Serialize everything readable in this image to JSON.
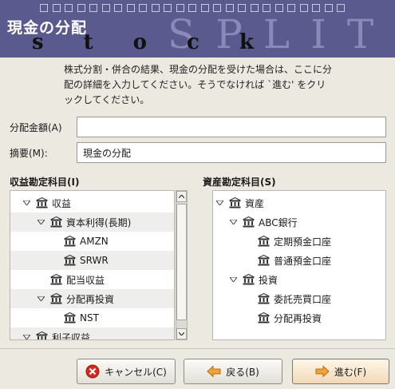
{
  "banner": {
    "title": "現金の分配",
    "deco_stock": "stock",
    "deco_split": "SPLIT"
  },
  "description": "株式分割・併合の結果、現金の分配を受けた場合は、ここに分配の詳細を入力してください。そうでなければ `進む' をクリックしてください。",
  "form": {
    "amount_label": "分配金額(A)",
    "amount_value": "",
    "memo_label": "摘要(M):",
    "memo_value": "現金の分配"
  },
  "income_tree": {
    "title": "収益勘定科目(I)",
    "rows": [
      {
        "label": "収益",
        "expanded": true
      },
      {
        "label": "資本利得(長期)",
        "expanded": true
      },
      {
        "label": "AMZN"
      },
      {
        "label": "SRWR"
      },
      {
        "label": "配当収益"
      },
      {
        "label": "分配再投資",
        "expanded": true
      },
      {
        "label": "NST"
      },
      {
        "label": "利子収益",
        "expanded": true
      }
    ]
  },
  "asset_tree": {
    "title": "資産勘定科目(S)",
    "rows": [
      {
        "label": "資産",
        "expanded": true
      },
      {
        "label": "ABC銀行",
        "expanded": true
      },
      {
        "label": "定期預金口座"
      },
      {
        "label": "普通預金口座"
      },
      {
        "label": "投資",
        "expanded": true
      },
      {
        "label": "委託売買口座"
      },
      {
        "label": "分配再投資"
      }
    ]
  },
  "buttons": {
    "cancel": "キャンセル(C)",
    "back": "戻る(B)",
    "next": "進む(F)"
  },
  "icons": {
    "account": "bank-icon",
    "expander": "triangle-down-icon",
    "cancel": "cancel-icon",
    "back": "arrow-left-icon",
    "next": "arrow-right-icon"
  },
  "colors": {
    "banner": "#5a5a8f",
    "cancel_icon": "#d42a1d",
    "arrow_icon": "#f2a23a"
  }
}
